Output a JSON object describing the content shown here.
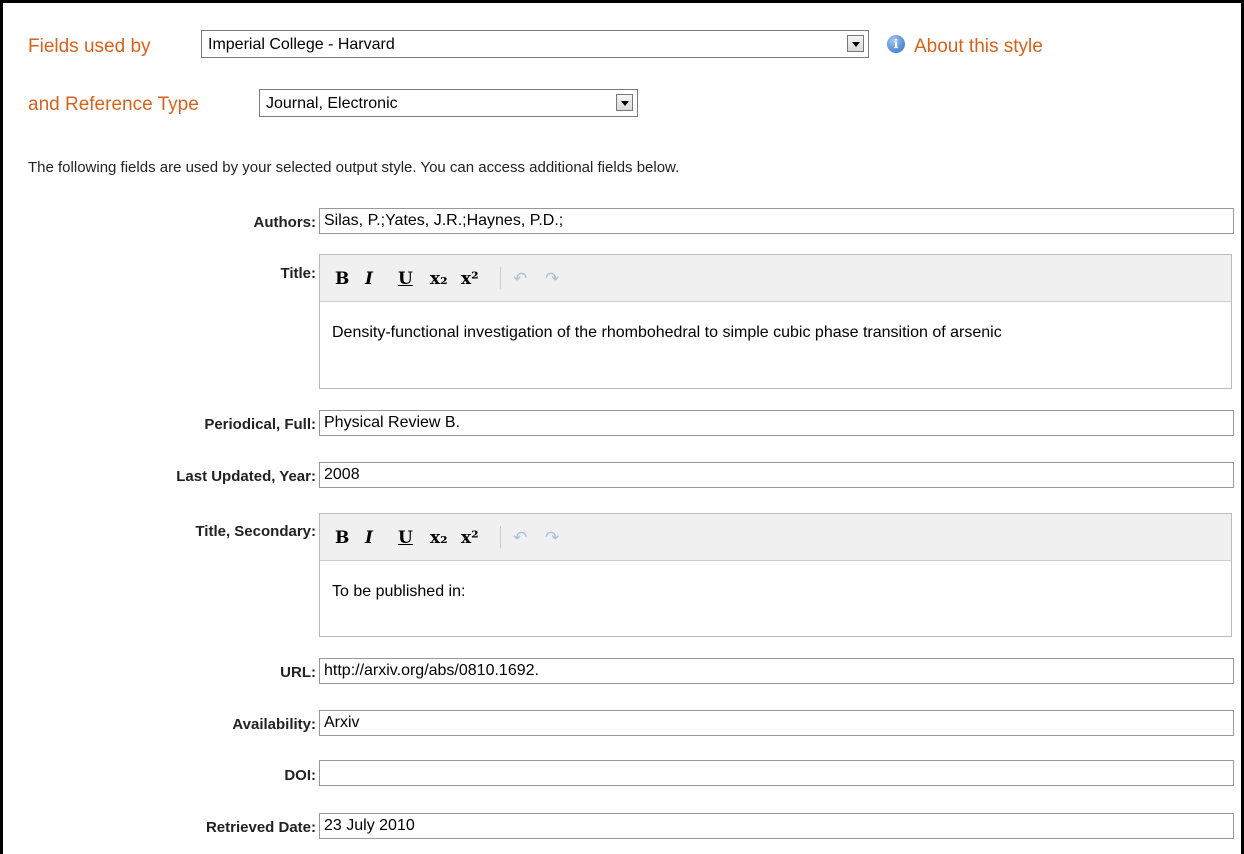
{
  "style_selector": {
    "label": "Fields used by",
    "value": "Imperial College - Harvard",
    "about_link": "About this style"
  },
  "reference_type": {
    "label": "and Reference Type",
    "value": "Journal, Electronic"
  },
  "description": "The following fields are used by your selected output style. You can access additional fields below.",
  "fields": {
    "authors": {
      "label": "Authors:",
      "value": "Silas, P.;Yates, J.R.;Haynes, P.D.;"
    },
    "title": {
      "label": "Title:",
      "value": "Density-functional investigation of the rhombohedral to simple cubic phase transition of arsenic"
    },
    "periodical_full": {
      "label": "Periodical, Full:",
      "value": "Physical Review B."
    },
    "last_updated_year": {
      "label": "Last Updated, Year:",
      "value": "2008"
    },
    "title_secondary": {
      "label": "Title, Secondary:",
      "value": "To be published in:"
    },
    "url": {
      "label": "URL:",
      "value": "http://arxiv.org/abs/0810.1692."
    },
    "availability": {
      "label": "Availability:",
      "value": "Arxiv"
    },
    "doi": {
      "label": "DOI:",
      "value": ""
    },
    "retrieved_date": {
      "label": "Retrieved Date:",
      "value": "23 July 2010"
    }
  },
  "toolbar": {
    "bold": "B",
    "italic": "I",
    "underline": "U",
    "subscript": "x₂",
    "superscript": "x²",
    "undo": "↶",
    "redo": "↷"
  },
  "icons": {
    "info": "i",
    "dropdown": "chevron-down-icon"
  },
  "colors": {
    "label_orange": "#d7621c",
    "info_blue": "#2f6fc7"
  }
}
